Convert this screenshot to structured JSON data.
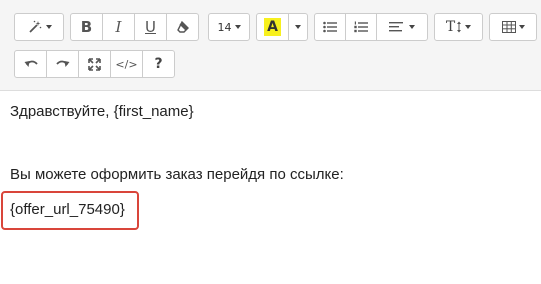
{
  "toolbar": {
    "font_size_value": "14",
    "bold_label": "B",
    "italic_label": "I",
    "underline_label": "U",
    "highlight_label": "A",
    "text_style_label": "T",
    "help_label": "?",
    "code_label": "</>"
  },
  "editor": {
    "greeting": "Здравствуйте, {first_name}",
    "order_text": "Вы можете оформить заказ перейдя по ссылке:",
    "placeholder_token": "{offer_url_75490}"
  },
  "colors": {
    "highlight_bg": "#f7f01e",
    "focus_border": "#d9453a"
  }
}
